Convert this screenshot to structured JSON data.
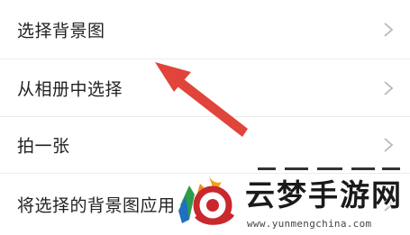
{
  "menu": {
    "items": [
      {
        "label": "选择背景图"
      },
      {
        "label": "从相册中选择"
      },
      {
        "label": "拍一张"
      },
      {
        "label": "将选择的背景图应用"
      }
    ]
  },
  "watermark": {
    "title": "云梦手游网",
    "url": "www.yunmengchina.com"
  },
  "colors": {
    "arrow": "#e0443a",
    "chevron": "#b8b8b8",
    "text": "#222222"
  }
}
